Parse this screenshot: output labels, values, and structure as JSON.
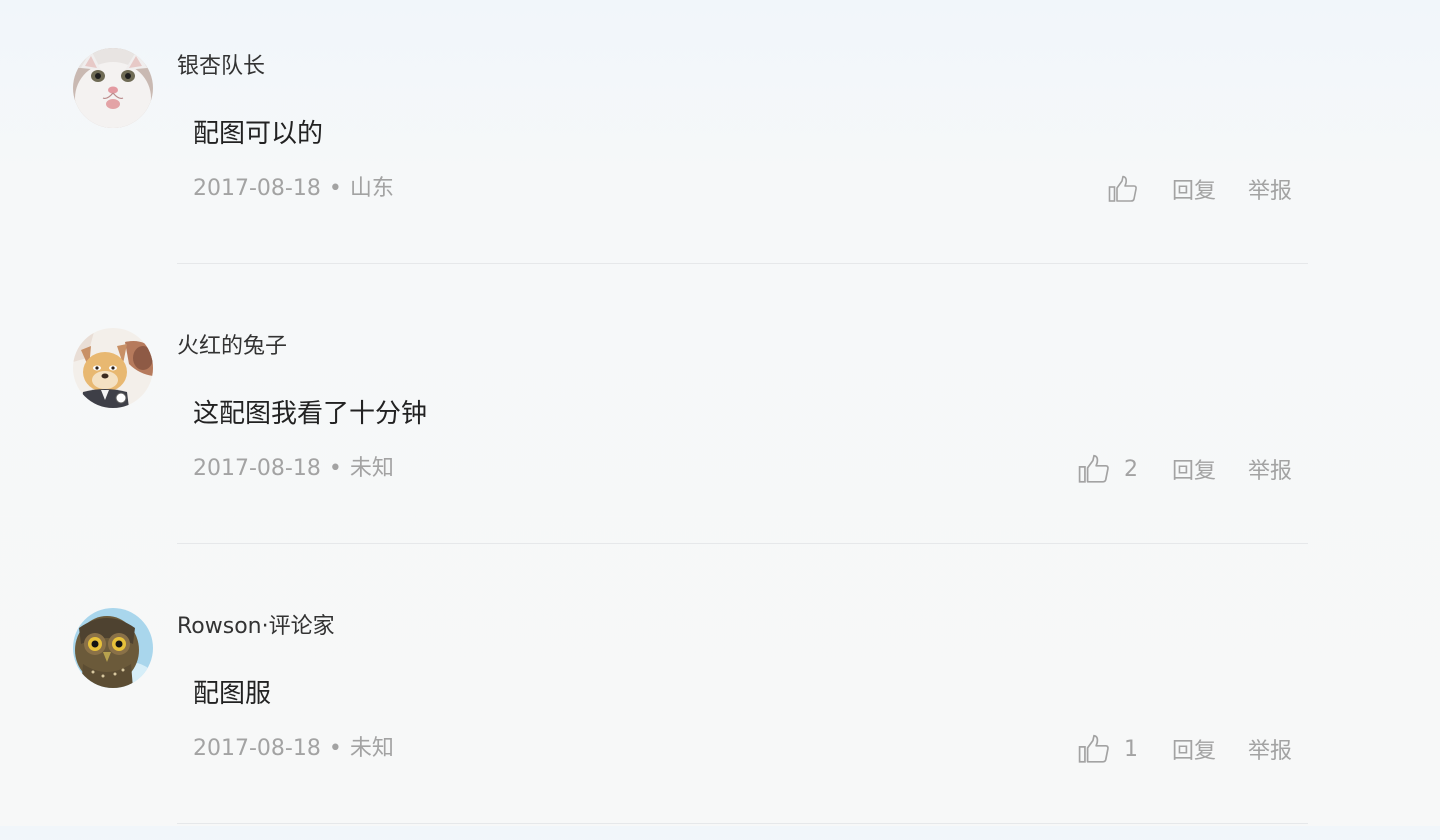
{
  "comments": [
    {
      "username": "银杏队长",
      "avatar_icon": "white-cat-avatar-icon",
      "content": "配图可以的",
      "date": "2017-08-18",
      "separator": "•",
      "location": "山东",
      "like_count": "",
      "reply_label": "回复",
      "report_label": "举报"
    },
    {
      "username": "火红的兔子",
      "avatar_icon": "cartoon-dog-avatar-icon",
      "content": "这配图我看了十分钟",
      "date": "2017-08-18",
      "separator": "•",
      "location": "未知",
      "like_count": "2",
      "reply_label": "回复",
      "report_label": "举报"
    },
    {
      "username": "Rowson·评论家",
      "avatar_icon": "owl-avatar-icon",
      "content": "配图服",
      "date": "2017-08-18",
      "separator": "•",
      "location": "未知",
      "like_count": "1",
      "reply_label": "回复",
      "report_label": "举报"
    }
  ],
  "colors": {
    "text_primary": "#333333",
    "text_muted": "#a3a3a3",
    "divider": "#e6e8ea",
    "background": "#f7f8f8"
  }
}
